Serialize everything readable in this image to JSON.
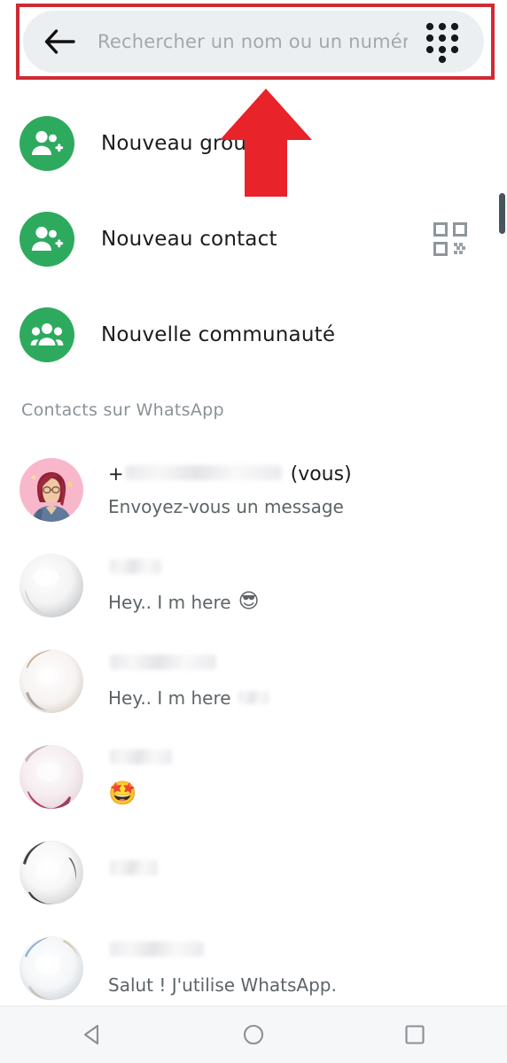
{
  "search": {
    "placeholder": "Rechercher un nom ou un numéro...",
    "value": "",
    "back_icon": "back-arrow-icon",
    "dialpad_icon": "dialpad-icon"
  },
  "annotations": {
    "highlight_color": "#cf2b33",
    "arrow_color": "#e8232a",
    "highlight_target": "search-bar",
    "arrow_target": "search-bar"
  },
  "actions": [
    {
      "label": "Nouveau groupe",
      "icon": "new-group-icon",
      "icon_color": "#2eaa5e",
      "trailing_icon": ""
    },
    {
      "label": "Nouveau contact",
      "icon": "new-contact-icon",
      "icon_color": "#2eaa5e",
      "trailing_icon": "qr-code-icon"
    },
    {
      "label": "Nouvelle communauté",
      "icon": "new-community-icon",
      "icon_color": "#2eaa5e",
      "trailing_icon": ""
    }
  ],
  "section": {
    "title": "Contacts sur WhatsApp"
  },
  "contacts": [
    {
      "name_prefix": "+",
      "name_redacted": true,
      "name_suffix": "(vous)",
      "status": "Envoyez-vous un message",
      "status_redacted": false,
      "emoji": "",
      "avatar_type": "photo-woman-pink"
    },
    {
      "name_prefix": "",
      "name_redacted": true,
      "name_suffix": "",
      "status": "Hey.. I m here",
      "status_redacted": false,
      "emoji": "😎",
      "avatar_type": "photo-blurred-gray"
    },
    {
      "name_prefix": "",
      "name_redacted": true,
      "name_suffix": "",
      "status": "Hey.. I m here",
      "status_redacted": true,
      "emoji": "",
      "avatar_type": "photo-blurred-tan"
    },
    {
      "name_prefix": "",
      "name_redacted": true,
      "name_suffix": "",
      "status": "",
      "status_redacted": false,
      "emoji": "🤩",
      "avatar_type": "photo-blurred-pink"
    },
    {
      "name_prefix": "",
      "name_redacted": true,
      "name_suffix": "",
      "status": "",
      "status_redacted": false,
      "emoji": "",
      "avatar_type": "photo-blurred-dark"
    },
    {
      "name_prefix": "",
      "name_redacted": true,
      "name_suffix": "",
      "status": "Salut ! J'utilise WhatsApp.",
      "status_redacted": false,
      "emoji": "",
      "avatar_type": "photo-blurred-blue"
    }
  ],
  "navbar": {
    "back": "back-nav-icon",
    "home": "home-nav-icon",
    "recents": "recents-nav-icon"
  },
  "scrollbar": {
    "visible": true,
    "thumb_color": "#45565f"
  }
}
